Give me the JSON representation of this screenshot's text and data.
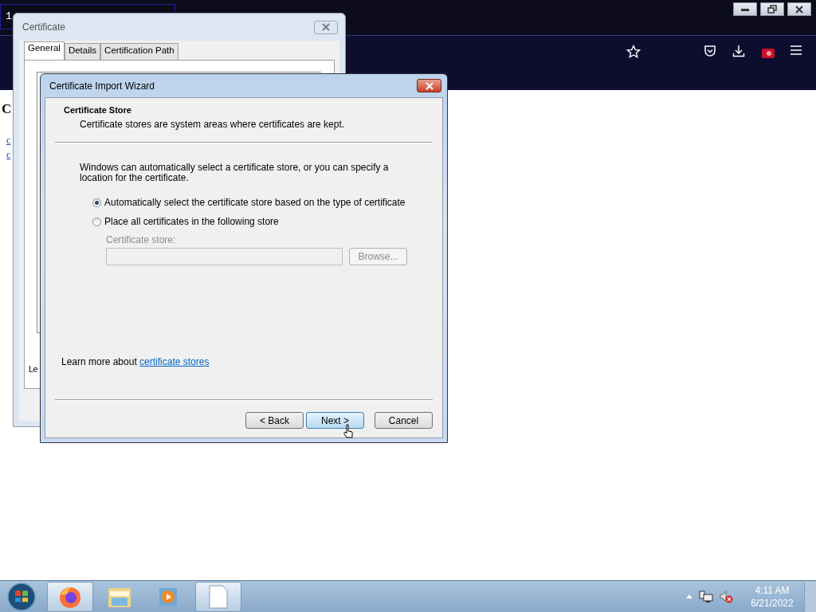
{
  "browser": {
    "tab": {
      "title": "1"
    },
    "page": {
      "heading": "C",
      "links": [
        "c",
        "c"
      ]
    }
  },
  "certificate_dialog": {
    "title": "Certificate",
    "tabs": [
      {
        "label": "General",
        "selected": true
      },
      {
        "label": "Details",
        "selected": false
      },
      {
        "label": "Certification Path",
        "selected": false
      }
    ],
    "fragment": "Le"
  },
  "wizard": {
    "title": "Certificate Import Wizard",
    "header": {
      "title": "Certificate Store",
      "subtitle": "Certificate stores are system areas where certificates are kept."
    },
    "intro": "Windows can automatically select a certificate store, or you can specify a location for the certificate.",
    "options": [
      {
        "label": "Automatically select the certificate store based on the type of certificate",
        "selected": true
      },
      {
        "label": "Place all certificates in the following store",
        "selected": false
      }
    ],
    "store_field": {
      "label": "Certificate store:",
      "disabled": true
    },
    "browse_button": {
      "label": "Browse...",
      "disabled": true
    },
    "learn_more": {
      "text": "Learn more about",
      "link": "certificate stores"
    },
    "buttons": [
      {
        "label": "< Back",
        "focused": false
      },
      {
        "label": "Next >",
        "focused": true
      },
      {
        "label": "Cancel",
        "focused": false
      }
    ]
  },
  "taskbar": {
    "apps": [
      {
        "kind": "firefox",
        "active": true
      },
      {
        "kind": "explorer",
        "active": false
      },
      {
        "kind": "media",
        "active": false
      },
      {
        "kind": "document",
        "active": true
      }
    ],
    "clock": {
      "time": "4:11 AM",
      "date": "6/21/2022"
    }
  }
}
